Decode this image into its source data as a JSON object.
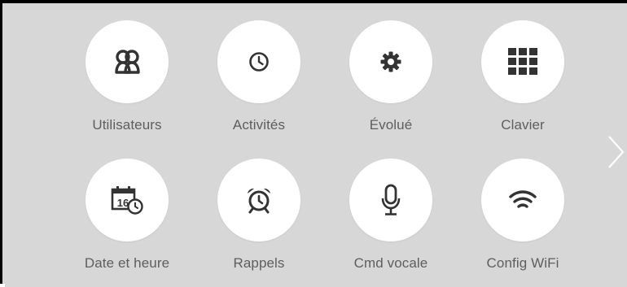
{
  "menu": {
    "items": [
      {
        "label": "Utilisateurs",
        "icon": "users-icon"
      },
      {
        "label": "Activités",
        "icon": "clock-icon"
      },
      {
        "label": "Évolué",
        "icon": "gear-icon"
      },
      {
        "label": "Clavier",
        "icon": "keypad-icon"
      },
      {
        "label": "Date et heure",
        "icon": "calendar-clock-icon",
        "calendar_day": "16"
      },
      {
        "label": "Rappels",
        "icon": "alarm-clock-icon"
      },
      {
        "label": "Cmd vocale",
        "icon": "microphone-icon"
      },
      {
        "label": "Config WiFi",
        "icon": "wifi-icon"
      }
    ]
  },
  "pager": {
    "next_icon": "chevron-right-icon"
  },
  "colors": {
    "background": "#d7d7d7",
    "circle": "#ffffff",
    "icon": "#333333",
    "label": "#5e5e5e",
    "chevron": "#ffffff"
  }
}
